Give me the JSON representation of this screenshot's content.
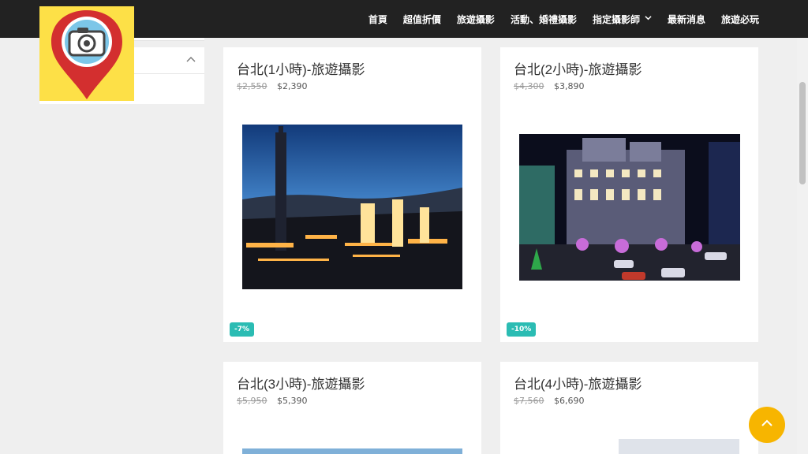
{
  "nav": {
    "items": [
      {
        "label": "首頁"
      },
      {
        "label": "超值折價"
      },
      {
        "label": "旅遊攝影"
      },
      {
        "label": "活動、婚禮攝影"
      },
      {
        "label": "指定攝影師"
      },
      {
        "label": "最新消息"
      },
      {
        "label": "旅遊必玩"
      }
    ]
  },
  "logo": {
    "icon": "camera-location-pin-icon",
    "bg": "#fde047",
    "pin_color": "#d32f2f"
  },
  "products": [
    {
      "title": "台北(1小時)-旅遊攝影",
      "old_price": "$2,550",
      "new_price": "$2,390",
      "badge": "-7%"
    },
    {
      "title": "台北(2小時)-旅遊攝影",
      "old_price": "$4,300",
      "new_price": "$3,890",
      "badge": "-10%"
    },
    {
      "title": "台北(3小時)-旅遊攝影",
      "old_price": "$5,950",
      "new_price": "$5,390"
    },
    {
      "title": "台北(4小時)-旅遊攝影",
      "old_price": "$7,560",
      "new_price": "$6,690"
    }
  ],
  "colors": {
    "nav_bg": "#222222",
    "badge": "#2bbcb3",
    "back_to_top": "#f7b500",
    "page_bg": "#efefef"
  }
}
